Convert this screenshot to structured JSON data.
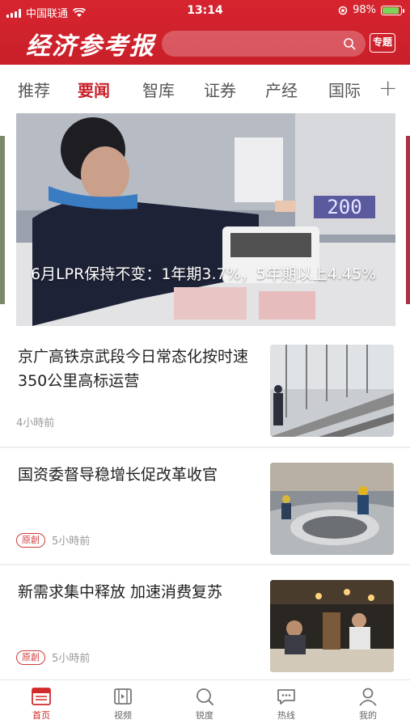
{
  "status_bar": {
    "carrier": "中国联通",
    "time": "13:14",
    "battery": "98%"
  },
  "header": {
    "brand": "经济参考报",
    "topic_button": "专题",
    "search_placeholder": ""
  },
  "tabs": [
    {
      "label": "推荐",
      "active": false
    },
    {
      "label": "要闻",
      "active": true
    },
    {
      "label": "智库",
      "active": false
    },
    {
      "label": "证券",
      "active": false
    },
    {
      "label": "产经",
      "active": false
    },
    {
      "label": "国际",
      "active": false
    }
  ],
  "add_channel_icon": "plus-icon",
  "hero": {
    "caption": "6月LPR保持不变：1年期3.7%，5年期以上4.45%",
    "counter_display": "200"
  },
  "news": [
    {
      "title": "京广高铁京武段今日常态化按时速350公里高标运营",
      "badge": "",
      "time": "4小時前"
    },
    {
      "title": "国资委督导稳增长促改革收官",
      "badge": "原創",
      "time": "5小時前"
    },
    {
      "title": "新需求集中释放 加速消费复苏",
      "badge": "原創",
      "time": "5小時前"
    }
  ],
  "bottom_nav": [
    {
      "label": "首页",
      "icon": "news-icon",
      "active": true
    },
    {
      "label": "视频",
      "icon": "video-icon",
      "active": false
    },
    {
      "label": "锐度",
      "icon": "search-icon",
      "active": false
    },
    {
      "label": "热线",
      "icon": "chat-icon",
      "active": false
    },
    {
      "label": "我的",
      "icon": "user-icon",
      "active": false
    }
  ],
  "colors": {
    "brand_red": "#c9202a",
    "active_tab": "#c9202a",
    "badge": "#d23b3b"
  }
}
